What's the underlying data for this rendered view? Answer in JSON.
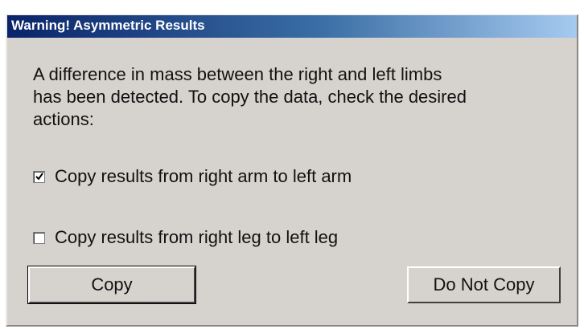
{
  "dialog": {
    "title": "Warning! Asymmetric Results",
    "message_lines": [
      "A difference in mass between the right and left limbs",
      "has been detected.  To copy the data, check the desired",
      "actions:"
    ],
    "options": [
      {
        "label": "Copy results from right arm to left arm",
        "checked": true
      },
      {
        "label": "Copy results from right leg to left leg",
        "checked": false
      }
    ],
    "buttons": {
      "copy_label": "Copy",
      "do_not_copy_label": "Do Not Copy"
    }
  },
  "colors": {
    "dialog_background": "#d6d3ce",
    "titlebar_start": "#0a246a",
    "titlebar_end": "#a6caf0",
    "title_text": "#ffffff"
  }
}
